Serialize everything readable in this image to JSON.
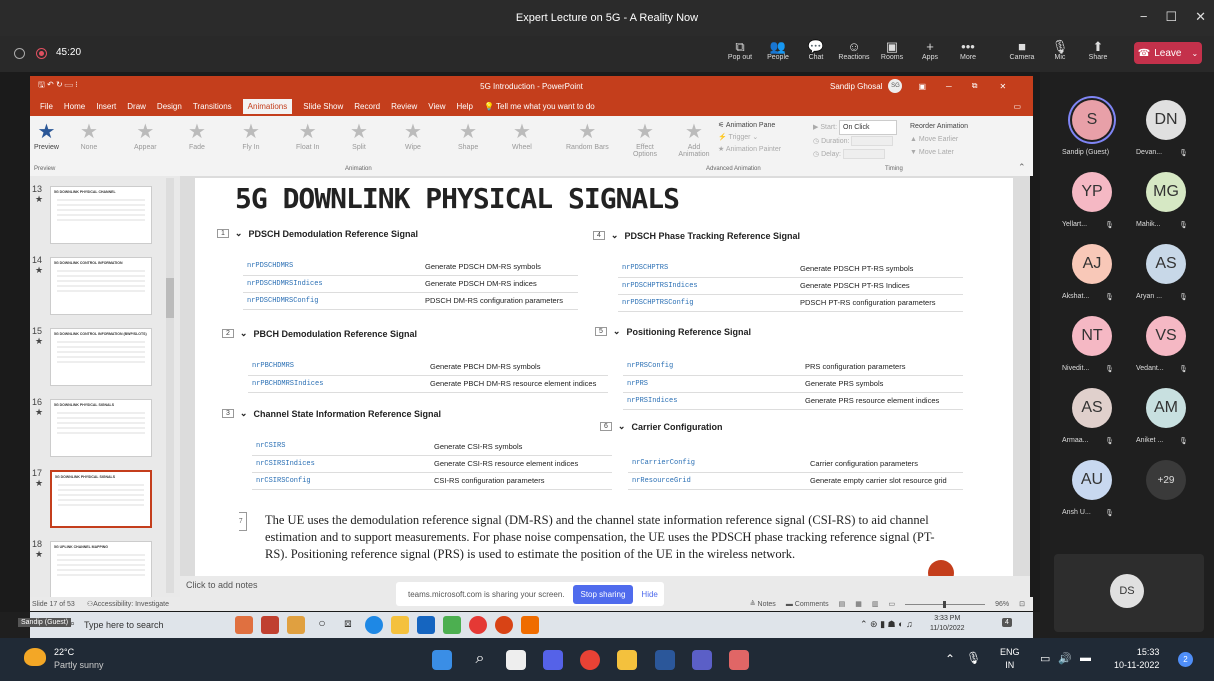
{
  "window": {
    "title": "Expert Lecture on 5G - A Reality Now",
    "minimize": "−",
    "maximize": "☐",
    "close": "✕"
  },
  "meeting": {
    "timer": "45:20",
    "buttons": [
      {
        "icon": "pop-out-icon",
        "glyph": "⧉",
        "label": "Pop out"
      },
      {
        "icon": "people-icon",
        "glyph": "👥",
        "label": "People"
      },
      {
        "icon": "chat-icon",
        "glyph": "💬",
        "label": "Chat"
      },
      {
        "icon": "reactions-icon",
        "glyph": "☺",
        "label": "Reactions"
      },
      {
        "icon": "rooms-icon",
        "glyph": "▣",
        "label": "Rooms"
      },
      {
        "icon": "apps-icon",
        "glyph": "+",
        "label": "Apps"
      },
      {
        "icon": "more-icon",
        "glyph": "•••",
        "label": "More"
      },
      {
        "icon": "camera-icon",
        "glyph": "■",
        "label": "Camera"
      },
      {
        "icon": "mic-icon",
        "glyph": "🎙",
        "label": "Mic"
      },
      {
        "icon": "share-icon",
        "glyph": "⬆",
        "label": "Share"
      }
    ],
    "leave_label": "Leave"
  },
  "powerpoint": {
    "title": "5G Introduction - PowerPoint",
    "user": "Sandip Ghosal",
    "user_initials": "SG",
    "menu": [
      "File",
      "Home",
      "Insert",
      "Draw",
      "Design",
      "Transitions",
      "Animations",
      "Slide Show",
      "Record",
      "Review",
      "View",
      "Help"
    ],
    "active_menu": "Animations",
    "tell_me": "Tell me what you want to do",
    "ribbon": {
      "preview": "Preview",
      "preview_group": "Preview",
      "animations": [
        "None",
        "Appear",
        "Fade",
        "Fly In",
        "Float In",
        "Split",
        "Wipe",
        "Shape",
        "Wheel",
        "Random Bars"
      ],
      "animation_group": "Animation",
      "effect_options": "Effect Options",
      "add_animation": "Add Animation",
      "animation_pane": "Animation Pane",
      "trigger": "Trigger",
      "animation_painter": "Animation Painter",
      "advanced_group": "Advanced Animation",
      "start_label": "Start:",
      "start_value": "On Click",
      "duration_label": "Duration:",
      "delay_label": "Delay:",
      "timing_group": "Timing",
      "reorder": "Reorder Animation",
      "move_earlier": "Move Earlier",
      "move_later": "Move Later"
    },
    "thumbnails": [
      {
        "num": "13",
        "title": "5G DOWNLINK PHYSICAL CHANNEL"
      },
      {
        "num": "14",
        "title": "5G DOWNLINK CONTROL INFORMATION"
      },
      {
        "num": "15",
        "title": "5G DOWNLINK CONTROL INFORMATION (BWP/SLOTS)"
      },
      {
        "num": "16",
        "title": "5G DOWNLINK PHYSICAL SIGNALS"
      },
      {
        "num": "17",
        "title": "5G DOWNLINK PHYSICAL SIGNALS"
      },
      {
        "num": "18",
        "title": "5G UPLINK CHANNEL MAPPING"
      }
    ],
    "slide": {
      "title": "5G DOWNLINK PHYSICAL SIGNALS",
      "sections": [
        {
          "num": "1",
          "heading": "PDSCH Demodulation Reference Signal",
          "rows": [
            [
              "nrPDSCHDMRS",
              "Generate PDSCH DM-RS symbols"
            ],
            [
              "nrPDSCHDMRSIndices",
              "Generate PDSCH DM-RS indices"
            ],
            [
              "nrPDSCHDMRSConfig",
              "PDSCH DM-RS configuration parameters"
            ]
          ]
        },
        {
          "num": "2",
          "heading": "PBCH Demodulation Reference Signal",
          "rows": [
            [
              "nrPBCHDMRS",
              "Generate PBCH DM-RS symbols"
            ],
            [
              "nrPBCHDMRSIndices",
              "Generate PBCH DM-RS resource element indices"
            ]
          ]
        },
        {
          "num": "3",
          "heading": "Channel State Information Reference Signal",
          "rows": [
            [
              "nrCSIRS",
              "Generate CSI-RS symbols"
            ],
            [
              "nrCSIRSIndices",
              "Generate CSI-RS resource element indices"
            ],
            [
              "nrCSIRSConfig",
              "CSI-RS configuration parameters"
            ]
          ]
        },
        {
          "num": "4",
          "heading": "PDSCH Phase Tracking Reference Signal",
          "rows": [
            [
              "nrPDSCHPTRS",
              "Generate PDSCH PT-RS symbols"
            ],
            [
              "nrPDSCHPTRSIndices",
              "Generate PDSCH PT-RS Indices"
            ],
            [
              "nrPDSCHPTRSConfig",
              "PDSCH PT-RS configuration parameters"
            ]
          ]
        },
        {
          "num": "5",
          "heading": "Positioning Reference Signal",
          "rows": [
            [
              "nrPRSConfig",
              "PRS configuration parameters"
            ],
            [
              "nrPRS",
              "Generate PRS symbols"
            ],
            [
              "nrPRSIndices",
              "Generate PRS resource element indices"
            ]
          ]
        },
        {
          "num": "6",
          "heading": "Carrier Configuration",
          "rows": [
            [
              "nrCarrierConfig",
              "Carrier configuration parameters"
            ],
            [
              "nrResourceGrid",
              "Generate empty carrier slot resource grid"
            ]
          ]
        }
      ],
      "para_num": "7",
      "paragraph": "The UE uses the demodulation reference signal (DM-RS) and the channel state information reference signal (CSI-RS) to aid channel estimation and to support measurements. For phase noise compensation, the UE uses the PDSCH phase tracking reference signal (PT-RS). Positioning reference signal (PRS) is used to estimate the position of the UE in the wireless network."
    },
    "notes": "Click to add notes",
    "status": {
      "slide": "Slide 17 of 53",
      "accessibility": "Accessibility: Investigate",
      "notes": "Notes",
      "comments": "Comments",
      "zoom": "96%"
    }
  },
  "sharing_bar": {
    "text": "teams.microsoft.com is sharing your screen.",
    "stop": "Stop sharing",
    "hide": "Hide"
  },
  "remote_taskbar": {
    "user": "Sandip (Guest)",
    "search": "Type here to search",
    "time": "3:33 PM",
    "date": "11/10/2022",
    "badge": "4"
  },
  "participants": [
    {
      "initials": "S",
      "name": "Sandip (Guest)",
      "color": "#e8a0a8",
      "ring": true
    },
    {
      "initials": "DN",
      "name": "Devan...",
      "color": "#e0e0e0"
    },
    {
      "initials": "YP",
      "name": "Yellart...",
      "color": "#f5b8c4"
    },
    {
      "initials": "MG",
      "name": "Mahik...",
      "color": "#d6e8c4"
    },
    {
      "initials": "AJ",
      "name": "Akshat...",
      "color": "#f8c8b8"
    },
    {
      "initials": "AS",
      "name": "Aryan ...",
      "color": "#c8d8e8"
    },
    {
      "initials": "NT",
      "name": "Nivedit...",
      "color": "#f5b8c4"
    },
    {
      "initials": "VS",
      "name": "Vedant...",
      "color": "#f5b8c4"
    },
    {
      "initials": "AS",
      "name": "Armaa...",
      "color": "#e0d0cc"
    },
    {
      "initials": "AM",
      "name": "Aniket ...",
      "color": "#c8e0e0"
    },
    {
      "initials": "AU",
      "name": "Ansh U...",
      "color": "#c8d8f0"
    }
  ],
  "overflow": "+29",
  "self_view": "DS",
  "taskbar": {
    "temp": "22°C",
    "weather": "Partly sunny",
    "lang1": "ENG",
    "lang2": "IN",
    "time": "15:33",
    "date": "10-11-2022",
    "notif": "2"
  }
}
